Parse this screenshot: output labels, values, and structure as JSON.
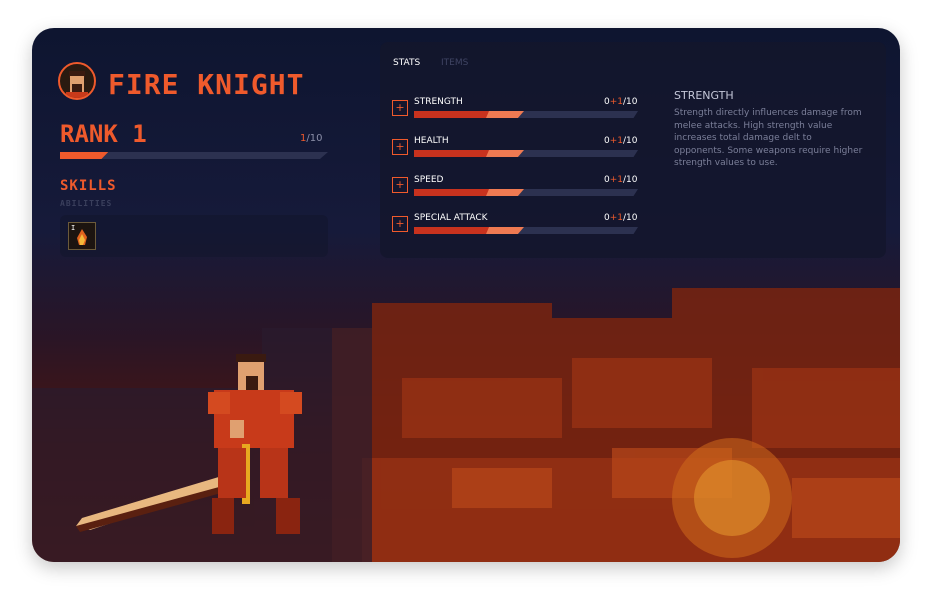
{
  "character": {
    "name": "FIRE KNIGHT"
  },
  "rank": {
    "label": "RANK 1",
    "current": "1",
    "max": "/10",
    "progress": 0.1
  },
  "skills": {
    "heading": "SKILLS",
    "subheading": "ABILITIES",
    "slots": [
      {
        "key": "I",
        "icon": "fire-ability-icon"
      }
    ]
  },
  "tabs": {
    "stats": "STATS",
    "items": "ITEMS"
  },
  "stats": [
    {
      "name": "STRENGTH",
      "base": "0",
      "bonus": "+1",
      "max": "/10"
    },
    {
      "name": "HEALTH",
      "base": "0",
      "bonus": "+1",
      "max": "/10"
    },
    {
      "name": "SPEED",
      "base": "0",
      "bonus": "+1",
      "max": "/10"
    },
    {
      "name": "SPECIAL ATTACK",
      "base": "0",
      "bonus": "+1",
      "max": "/10"
    }
  ],
  "description": {
    "title": "STRENGTH",
    "body": "Strength directly influences damage from melee attacks. High strength value increases total damage delt to opponents. Some weapons require higher strength values to use."
  },
  "colors": {
    "accent": "#ef5a2c",
    "bar_fill": "#c8321e",
    "bar_bonus": "#ef7a52",
    "track": "#2c3150"
  }
}
